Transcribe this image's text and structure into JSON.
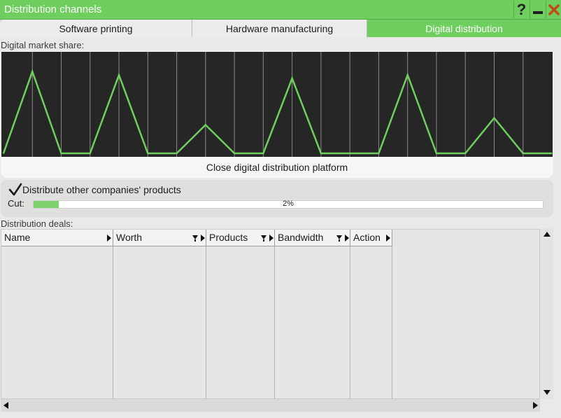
{
  "window": {
    "title": "Distribution channels"
  },
  "title_buttons": {
    "help": "?"
  },
  "tabs": [
    {
      "label": "Software printing",
      "active": false
    },
    {
      "label": "Hardware manufacturing",
      "active": false
    },
    {
      "label": "Digital distribution",
      "active": true
    }
  ],
  "market_share": {
    "label": "Digital market share:",
    "close_button": "Close digital distribution platform"
  },
  "chart_data": {
    "type": "line",
    "title": "",
    "xlabel": "",
    "ylabel": "",
    "grid": true,
    "ylim": [
      0,
      1
    ],
    "series": [
      {
        "values": [
          0.0,
          0.95,
          0.0,
          0.0,
          0.91,
          0.0,
          0.0,
          0.33,
          0.0,
          0.0,
          0.87,
          0.0,
          0.0,
          0.0,
          0.91,
          0.0,
          0.0,
          0.41,
          0.0,
          0.0
        ]
      }
    ]
  },
  "distribute": {
    "checkbox_label": "Distribute other companies' products",
    "checked": true,
    "cut_label": "Cut:",
    "cut_value": 0.05,
    "cut_text": "2%"
  },
  "deals": {
    "label": "Distribution deals:",
    "columns": [
      "Name",
      "Worth",
      "Products",
      "Bandwidth",
      "Action"
    ],
    "rows": []
  },
  "colors": {
    "accent": "#6fcf5e",
    "chart_line": "#6fcf5e",
    "chart_bg": "#262626",
    "close_icon": "#c44a1a"
  },
  "icons": [
    "help-icon",
    "minimize-icon",
    "close-icon",
    "checkmark-icon",
    "filter-icon",
    "sort-arrow-icon",
    "scroll-up-icon",
    "scroll-down-icon",
    "scroll-left-icon",
    "scroll-right-icon"
  ]
}
